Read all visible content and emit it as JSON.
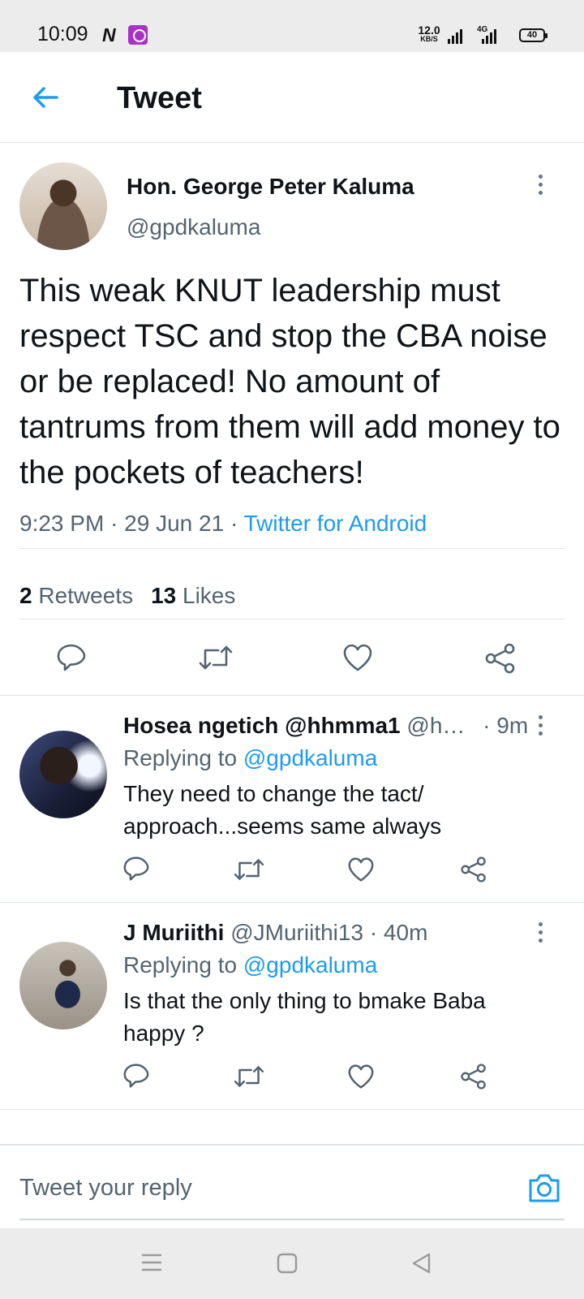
{
  "status_bar": {
    "time": "10:09",
    "n_icon": "N",
    "net_speed_value": "12.0",
    "net_speed_unit": "KB/S",
    "network_type": "4G",
    "battery": "40"
  },
  "header": {
    "title": "Tweet",
    "back_icon": "arrow-left-icon"
  },
  "tweet": {
    "author_name": "Hon. George Peter Kaluma",
    "author_handle": "@gpdkaluma",
    "text": "This weak KNUT leadership must respect TSC and stop the CBA noise or be replaced! No amount of tantrums from them will add money to the pockets of teachers!",
    "time": "9:23 PM",
    "date": "29 Jun 21",
    "source": "Twitter for Android",
    "retweets_count": "2",
    "retweets_label": "Retweets",
    "likes_count": "13",
    "likes_label": "Likes"
  },
  "replies": [
    {
      "name": "Hosea ngetich @hhmma1",
      "handle": "@h…",
      "time": "· 9m",
      "replying_label": "Replying to",
      "replying_to": "@gpdkaluma",
      "text": "They need to change the tact/ approach...seems  same always"
    },
    {
      "name": "J Muriithi",
      "handle": "@JMuriithi13",
      "time": "· 40m",
      "replying_label": "Replying to",
      "replying_to": "@gpdkaluma",
      "text": "Is that the only thing to bmake Baba happy ?"
    }
  ],
  "composer": {
    "placeholder": "Tweet your reply",
    "camera_icon": "camera-icon"
  },
  "colors": {
    "accent": "#1d9bf0",
    "secondary_text": "#536471",
    "primary_text": "#0f1419",
    "divider": "#dfe3e6"
  }
}
